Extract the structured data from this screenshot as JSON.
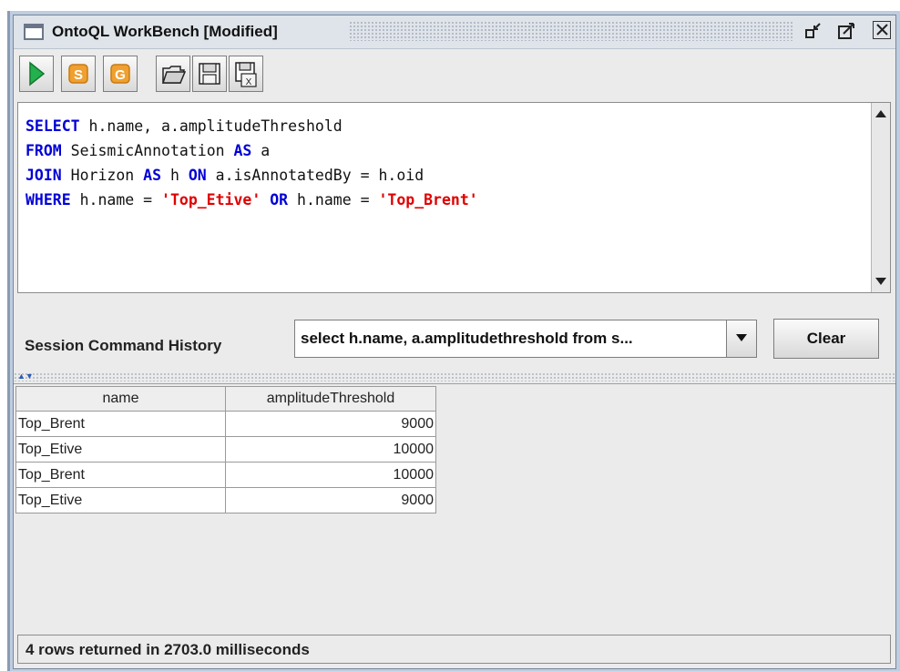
{
  "window": {
    "title": "OntoQL WorkBench [Modified]",
    "minimize_glyph": "⌐",
    "maximize_glyph": "◰",
    "close_glyph": "☒"
  },
  "toolbar": {
    "buttons": [
      {
        "name": "run-query-button",
        "icon": "play-icon",
        "color": "#22b14c"
      },
      {
        "name": "script-s-button",
        "icon": "script-s-icon",
        "color": "#f0a030",
        "glyph": "S"
      },
      {
        "name": "script-g-button",
        "icon": "script-g-icon",
        "color": "#f0a030",
        "glyph": "G"
      },
      {
        "name": "open-file-button",
        "icon": "folder-open-icon"
      },
      {
        "name": "save-button",
        "icon": "floppy-disk-icon"
      },
      {
        "name": "save-as-button",
        "icon": "floppy-disk-x-icon"
      }
    ]
  },
  "editor": {
    "lines": [
      [
        {
          "t": "SELECT",
          "k": "kw"
        },
        {
          "t": " h.name, a.amplitudeThreshold",
          "k": "txt"
        }
      ],
      [
        {
          "t": "FROM",
          "k": "kw"
        },
        {
          "t": " SeismicAnnotation ",
          "k": "txt"
        },
        {
          "t": "AS",
          "k": "kw"
        },
        {
          "t": " a",
          "k": "txt"
        }
      ],
      [
        {
          "t": "JOIN",
          "k": "kw"
        },
        {
          "t": " Horizon ",
          "k": "txt"
        },
        {
          "t": "AS",
          "k": "kw"
        },
        {
          "t": " h ",
          "k": "txt"
        },
        {
          "t": "ON",
          "k": "kw"
        },
        {
          "t": " a.isAnnotatedBy = h.oid",
          "k": "txt"
        }
      ],
      [
        {
          "t": "WHERE",
          "k": "kw"
        },
        {
          "t": " h.name = ",
          "k": "txt"
        },
        {
          "t": "'Top_Etive'",
          "k": "str"
        },
        {
          "t": " ",
          "k": "txt"
        },
        {
          "t": "OR",
          "k": "kw"
        },
        {
          "t": " h.name = ",
          "k": "txt"
        },
        {
          "t": "'Top_Brent'",
          "k": "str"
        }
      ]
    ]
  },
  "history": {
    "label": "Session Command History",
    "selected": "select h.name, a.amplitudethreshold from s...",
    "clear_label": "Clear"
  },
  "results": {
    "columns": [
      "name",
      "amplitudeThreshold"
    ],
    "rows": [
      [
        "Top_Brent",
        "9000"
      ],
      [
        "Top_Etive",
        "10000"
      ],
      [
        "Top_Brent",
        "10000"
      ],
      [
        "Top_Etive",
        "9000"
      ]
    ]
  },
  "status": {
    "text": "4 rows returned in 2703.0 milliseconds"
  },
  "colors": {
    "keyword": "#0000d6",
    "string": "#e00000",
    "frame": "#bfcde0"
  }
}
